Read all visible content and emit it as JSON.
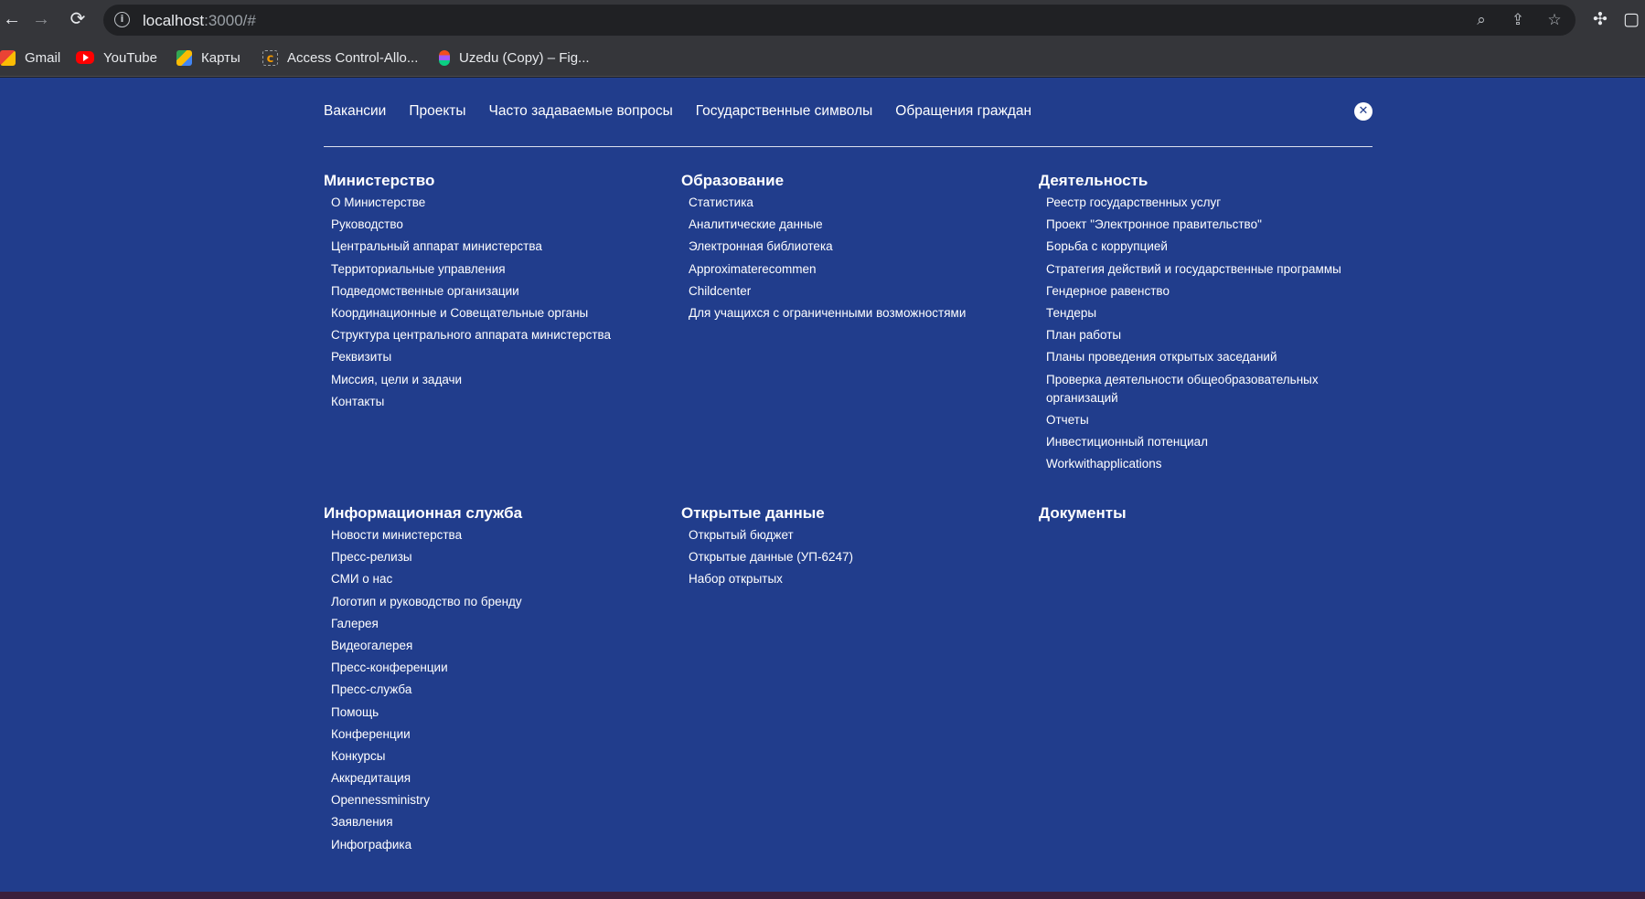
{
  "browser": {
    "url_host": "localhost",
    "url_rest": ":3000/#",
    "bookmarks": [
      {
        "label": "Gmail",
        "icon": "gmail-icon"
      },
      {
        "label": "YouTube",
        "icon": "youtube-icon"
      },
      {
        "label": "Карты",
        "icon": "maps-icon"
      },
      {
        "label": "Access Control-Allo...",
        "icon": "access-control-icon"
      },
      {
        "label": "Uzedu (Copy) – Fig...",
        "icon": "figma-icon"
      }
    ]
  },
  "colors": {
    "page_bg": "#213d8c",
    "chrome_bg": "#35363a",
    "text": "#ffffff"
  },
  "topnav": {
    "items": [
      "Вакансии",
      "Проекты",
      "Часто задаваемые вопросы",
      "Государственные символы",
      "Обращения граждан"
    ],
    "close_icon": "close-icon"
  },
  "sections": [
    {
      "title": "Министерство",
      "links": [
        "О Министерстве",
        "Руководство",
        "Центральный аппарат министерства",
        "Территориальные управления",
        "Подведомственные организации",
        "Координационные и Совещательные органы",
        "Структура центрального аппарата министерства",
        "Реквизиты",
        "Миссия, цели и задачи",
        "Контакты"
      ]
    },
    {
      "title": "Образование",
      "links": [
        "Статистика",
        "Аналитические данные",
        "Электронная библиотека",
        "Approximaterecommen",
        "Childcenter",
        "Для учащихся с ограниченными возможностями"
      ]
    },
    {
      "title": "Деятельность",
      "links": [
        "Реестр государственных услуг",
        "Проект \"Электронное правительство\"",
        "Борьба с коррупцией",
        "Стратегия действий и государственные программы",
        "Гендерное равенство",
        "Тендеры",
        "План работы",
        "Планы проведения открытых заседаний",
        "Проверка деятельности общеобразовательных организаций",
        "Отчеты",
        "Инвестиционный потенциал",
        "Workwithapplications"
      ]
    },
    {
      "title": "Информационная служба",
      "links": [
        "Новости министерства",
        "Пресс-релизы",
        "СМИ о нас",
        "Логотип и руководство по бренду",
        "Галерея",
        "Видеогалерея",
        "Пресс-конференции",
        "Пресс-служба",
        "Помощь",
        "Конференции",
        "Конкурсы",
        "Аккредитация",
        "Opennessministry",
        "Заявления",
        "Инфографика"
      ]
    },
    {
      "title": "Открытые данные",
      "links": [
        "Открытый бюджет",
        "Открытые данные (УП-6247)",
        "Набор открытых"
      ]
    },
    {
      "title": "Документы",
      "links": []
    }
  ]
}
